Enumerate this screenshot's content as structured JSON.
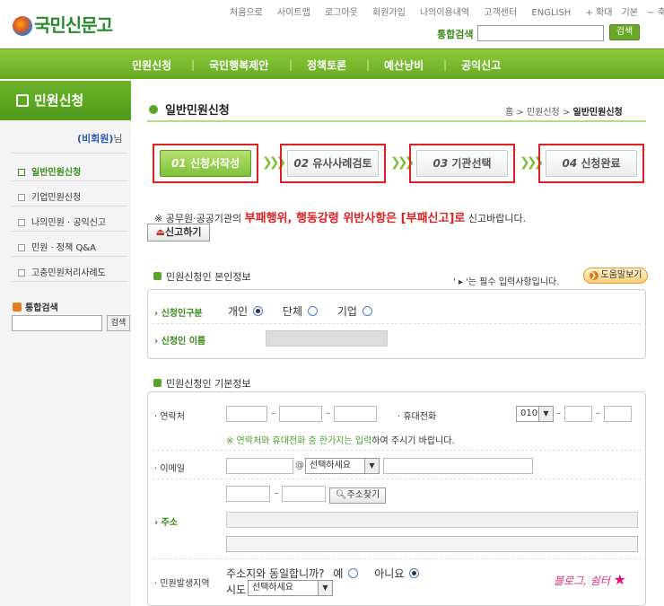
{
  "header": {
    "logo": "국민신문고",
    "top_links": [
      "처음으로",
      "사이트맵",
      "로그아웃",
      "회원가입",
      "나의이용내역",
      "고객센터",
      "ENGLISH"
    ],
    "zoom_in": "+ 확대",
    "zoom_default": "기본",
    "zoom_out": "− 축소",
    "search_label": "통합검색",
    "search_button": "검색",
    "search_value": ""
  },
  "nav": [
    "민원신청",
    "국민행복제안",
    "정책토론",
    "예산낭비",
    "공익신고"
  ],
  "sidebar": {
    "title": "민원신청",
    "member": "(비회원)",
    "member_suffix": "님",
    "items": [
      "일반민원신청",
      "기업민원신청",
      "나의민원 · 공익신고",
      "민원 · 정책 Q&A",
      "고충민원처리사례도"
    ],
    "search_label": "통합검색",
    "search_button": "검색"
  },
  "main": {
    "title": "일반민원신청",
    "breadcrumb": [
      "홈",
      "민원신청",
      "일반민원신청"
    ],
    "steps": [
      {
        "num": "01",
        "label": "신청서작성"
      },
      {
        "num": "02",
        "label": "유사사례검토"
      },
      {
        "num": "03",
        "label": "기관선택"
      },
      {
        "num": "04",
        "label": "신청완료"
      }
    ],
    "notice_pre": "※ 공무원·공공기관의",
    "notice_red": "부패행위, 행동강령 위반사항은 [부패신고]로",
    "notice_post": "신고바랍니다.",
    "report_button": "신고하기",
    "section1": "민원신청인 본인정보",
    "required_note": "' ▸ '는 필수 입력사항입니다.",
    "help_button": "도움말보기",
    "applicant_type_label": "신청인구분",
    "applicant_types": [
      "개인",
      "단체",
      "기업"
    ],
    "applicant_name_label": "신청인 이름",
    "section2": "민원신청인 기본정보",
    "contact_label": "연락처",
    "mobile_label": "휴대전화",
    "mobile_prefix": "010",
    "contact_note": "※ 연락처와 휴대전화 중 한가지는 입력",
    "contact_note2": "하여 주시기 바랍니다.",
    "email_label": "이메일",
    "email_select": "선택하세요",
    "address_label": "주소",
    "find_address": "주소찾기",
    "region_label": "민원발생지역",
    "same_address": "주소지와 동일합니까?",
    "yes": "예",
    "no": "아니요",
    "sido_label": "시도",
    "sido_select": "선택하세요",
    "watermark": "블로그, 쉼터"
  }
}
